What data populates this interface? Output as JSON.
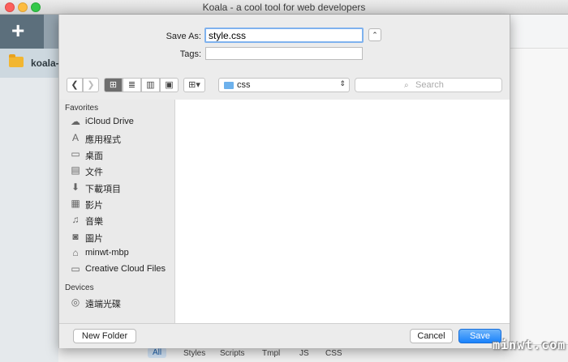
{
  "window": {
    "title": "Koala - a cool tool for web developers"
  },
  "koala": {
    "add_label": "+",
    "project_name": "koala-",
    "filters": [
      "All",
      "Styles",
      "Scripts",
      "Tmpl",
      "JS",
      "CSS"
    ]
  },
  "dialog": {
    "save_as_label": "Save As:",
    "save_as_value": "style.css",
    "tags_label": "Tags:",
    "tags_value": "",
    "expand_glyph": "⌃",
    "nav": {
      "back": "❮",
      "forward": "❯",
      "view_icon": "⊞",
      "view_list": "≣",
      "view_columns": "▥",
      "view_coverflow": "▣",
      "arrange": "⊞▾",
      "path_folder": "css",
      "path_arrows": "⇕",
      "search_placeholder": "Search",
      "search_icon": "magnifier-icon"
    },
    "sidebar": {
      "favorites_label": "Favorites",
      "favorites": [
        {
          "label": "iCloud Drive",
          "icon": "☁"
        },
        {
          "label": "應用程式",
          "icon": "A"
        },
        {
          "label": "桌面",
          "icon": "▭"
        },
        {
          "label": "文件",
          "icon": "▤"
        },
        {
          "label": "下載項目",
          "icon": "⬇"
        },
        {
          "label": "影片",
          "icon": "▦"
        },
        {
          "label": "音樂",
          "icon": "♫"
        },
        {
          "label": "圖片",
          "icon": "◙"
        },
        {
          "label": "minwt-mbp",
          "icon": "⌂"
        },
        {
          "label": "Creative Cloud Files",
          "icon": "▭"
        }
      ],
      "devices_label": "Devices",
      "devices": [
        {
          "label": "遠端光碟",
          "icon": "◎"
        }
      ]
    },
    "footer": {
      "new_folder": "New Folder",
      "cancel": "Cancel",
      "save": "Save"
    }
  },
  "watermark": "minwt.com"
}
